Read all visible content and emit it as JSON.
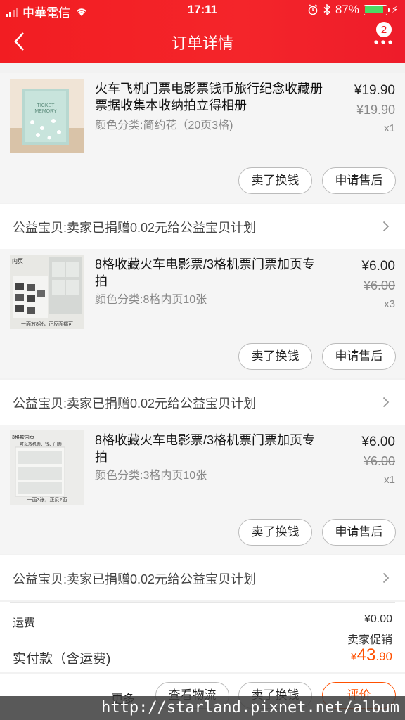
{
  "status_bar": {
    "carrier": "中華電信",
    "time": "17:11",
    "battery": "87%"
  },
  "nav": {
    "title": "订单详情",
    "badge": "2"
  },
  "items": [
    {
      "title": "火车飞机门票电影票钱币旅行纪念收藏册票据收集本收纳拍立得相册",
      "sku": "颜色分类:简约花（20页3格)",
      "price": "¥19.90",
      "original_price": "¥19.90",
      "quantity": "x1",
      "thumb_text": "TICKET MEMORY",
      "sell_label": "卖了换钱",
      "after_sale_label": "申请售后"
    },
    {
      "title": "8格收藏火车电影票/3格机票门票加页专拍",
      "sku": "颜色分类:8格内页10张",
      "price": "¥6.00",
      "original_price": "¥6.00",
      "quantity": "x3",
      "thumb_text": "内页",
      "thumb_caption": "一面放8张，正反面都可",
      "sell_label": "卖了换钱",
      "after_sale_label": "申请售后"
    },
    {
      "title": "8格收藏火车电影票/3格机票门票加页专拍",
      "sku": "颜色分类:3格内页10张",
      "price": "¥6.00",
      "original_price": "¥6.00",
      "quantity": "x1",
      "thumb_text": "3格款内页",
      "thumb_text2": "可以放机票、钱、门票",
      "thumb_caption": "一面3张，正反2面",
      "sell_label": "卖了换钱",
      "after_sale_label": "申请售后"
    }
  ],
  "charity_text": "公益宝贝:卖家已捐赠0.02元给公益宝贝计划",
  "summary": {
    "shipping_label": "运费",
    "shipping_value": "¥0.00",
    "promo_label": "卖家促销",
    "paid_label": "实付款（含运费)",
    "paid_currency": "¥",
    "paid_int": "43",
    "paid_dec": ".90"
  },
  "bottom_bar": {
    "more": "更多",
    "logistics": "查看物流",
    "sell": "卖了换钱",
    "review": "评价"
  },
  "watermark": "http://starland.pixnet.net/album",
  "colors": {
    "brand_red": "#f21d22",
    "accent_orange": "#ff5000"
  }
}
